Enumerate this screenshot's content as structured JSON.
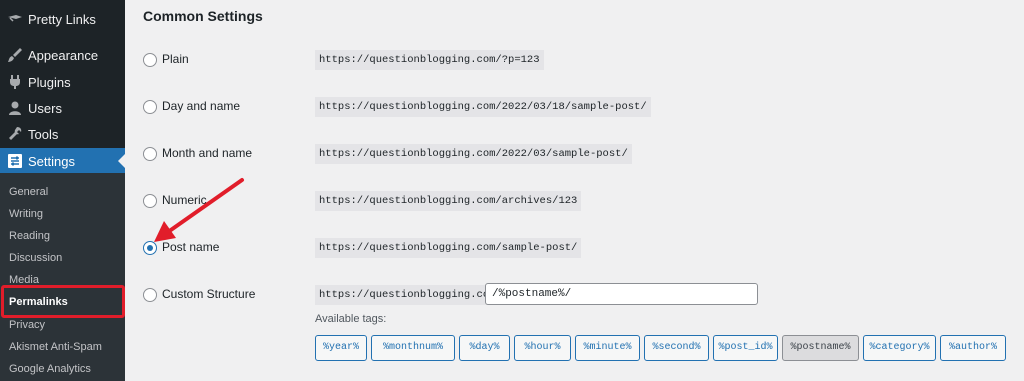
{
  "sidebar": {
    "items": [
      {
        "label": "Pretty Links",
        "icon": "pretty-links-icon"
      },
      {
        "label": "Appearance",
        "icon": "paintbrush-icon"
      },
      {
        "label": "Plugins",
        "icon": "plugin-icon"
      },
      {
        "label": "Users",
        "icon": "user-icon"
      },
      {
        "label": "Tools",
        "icon": "wrench-icon"
      },
      {
        "label": "Settings",
        "icon": "settings-icon",
        "active": true
      }
    ],
    "submenu": [
      "General",
      "Writing",
      "Reading",
      "Discussion",
      "Media",
      "Permalinks",
      "Privacy",
      "Akismet Anti-Spam",
      "Google Analytics"
    ],
    "current_submenu": "Permalinks"
  },
  "main": {
    "heading": "Common Settings",
    "options": [
      {
        "label": "Plain",
        "example": "https://questionblogging.com/?p=123",
        "checked": false
      },
      {
        "label": "Day and name",
        "example": "https://questionblogging.com/2022/03/18/sample-post/",
        "checked": false
      },
      {
        "label": "Month and name",
        "example": "https://questionblogging.com/2022/03/sample-post/",
        "checked": false
      },
      {
        "label": "Numeric",
        "example": "https://questionblogging.com/archives/123",
        "checked": false
      },
      {
        "label": "Post name",
        "example": "https://questionblogging.com/sample-post/",
        "checked": true
      },
      {
        "label": "Custom Structure",
        "example": "https://questionblogging.com",
        "checked": false
      }
    ],
    "custom_structure_value": "/%postname%/",
    "available_tags_label": "Available tags:",
    "tags": [
      "%year%",
      "%monthnum%",
      "%day%",
      "%hour%",
      "%minute%",
      "%second%",
      "%post_id%",
      "%postname%",
      "%category%",
      "%author%"
    ],
    "selected_tag": "%postname%"
  },
  "colors": {
    "sidebar_bg": "#1d2327",
    "accent": "#2271b1",
    "highlight": "#e11d2a",
    "annotation_arrow": "#e11d2a"
  }
}
